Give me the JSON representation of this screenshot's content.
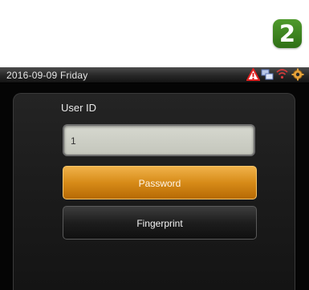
{
  "step_badge": "2",
  "status_bar": {
    "date": "2016-09-09",
    "weekday": "Friday",
    "icons": [
      "alert-triangle-icon",
      "network-icon",
      "wifi-icon",
      "gear-icon"
    ]
  },
  "form": {
    "user_id_label": "User ID",
    "user_id_value": "1",
    "password_label": "Password",
    "fingerprint_label": "Fingerprint"
  },
  "colors": {
    "selected_button": "#d78b18",
    "badge": "#3f8a22",
    "alert": "#e02020"
  }
}
